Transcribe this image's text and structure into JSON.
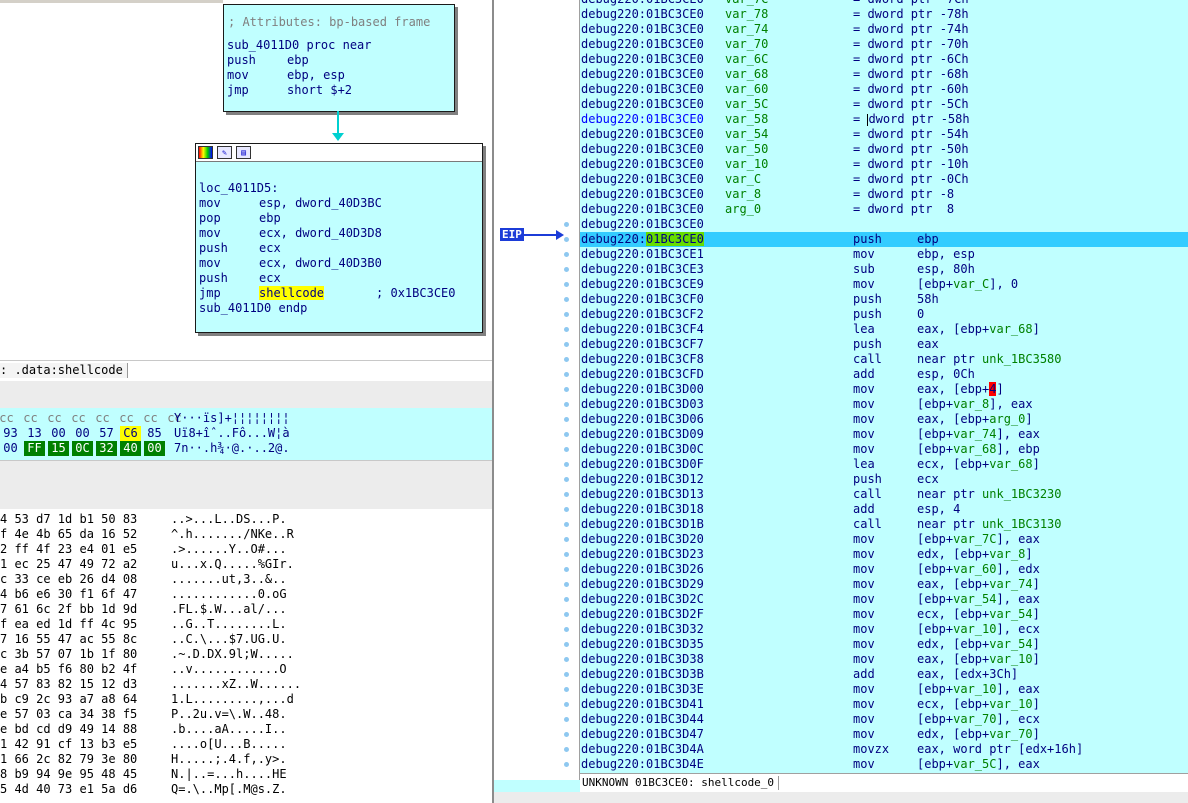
{
  "graph": {
    "node1": {
      "comment": "; Attributes: bp-based frame",
      "lines": [
        {
          "text": "sub_4011D0 proc near"
        },
        {
          "mnem": "push",
          "op": "ebp"
        },
        {
          "mnem": "mov",
          "op": "ebp, esp"
        },
        {
          "mnem": "jmp",
          "op": "short $+2"
        }
      ]
    },
    "node2": {
      "label": "loc_4011D5:",
      "lines": [
        {
          "mnem": "mov",
          "op": "esp, dword_40D3BC"
        },
        {
          "mnem": "pop",
          "op": "ebp"
        },
        {
          "mnem": "mov",
          "op": "ecx, dword_40D3D8"
        },
        {
          "mnem": "push",
          "op": "ecx"
        },
        {
          "mnem": "mov",
          "op": "ecx, dword_40D3B0"
        },
        {
          "mnem": "push",
          "op": "ecx"
        }
      ],
      "jmp_mnem": "jmp",
      "jmp_target": "shellcode",
      "jmp_comment": "; 0x1BC3CE0",
      "endp": "sub_4011D0 endp"
    }
  },
  "address_bar": ": .data:shellcode",
  "hex_view_1": {
    "rows": [
      {
        "bytes": [
          "cc",
          "cc",
          "cc",
          "cc",
          "cc",
          "cc",
          "cc",
          "cc"
        ],
        "ascii": "Y···ïs]+¦¦¦¦¦¦¦¦"
      },
      {
        "bytes": [
          "93",
          "13",
          "00",
          "00",
          "57",
          "C6",
          "85"
        ],
        "ascii": "Uï8+îˆ..Fô...W¦à"
      },
      {
        "bytes": [
          "00",
          "FF",
          "15",
          "0C",
          "32",
          "40",
          "00"
        ],
        "ascii": "7n··.h¾·@.·..2@."
      }
    ]
  },
  "hex_view_2": {
    "rows": [
      {
        "hex": "4 53 d7 1d b1 50 83",
        "ascii": "..>...L..DS...P."
      },
      {
        "hex": "f 4e 4b 65 da 16 52",
        "ascii": "^.h......./NKe..R"
      },
      {
        "hex": "2 ff 4f 23 e4 01 e5",
        "ascii": ".>......Y..O#..."
      },
      {
        "hex": "1 ec 25 47 49 72 a2",
        "ascii": "u...x.Q.....%GIr."
      },
      {
        "hex": "c 33 ce eb 26 d4 08",
        "ascii": ".......ut,3..&.."
      },
      {
        "hex": "4 b6 e6 30 f1 6f 47",
        "ascii": "............0.oG"
      },
      {
        "hex": "7 61 6c 2f bb 1d 9d",
        "ascii": ".FL.$.W...al/..."
      },
      {
        "hex": "f ea ed 1d ff 4c 95",
        "ascii": "..G..T........L."
      },
      {
        "hex": "7 16 55 47 ac 55 8c",
        "ascii": "..C.\\...$7.UG.U."
      },
      {
        "hex": "c 3b 57 07 1b 1f 80",
        "ascii": ".~.D.DX.9l;W....."
      },
      {
        "hex": "e a4 b5 f6 80 b2 4f",
        "ascii": "..v............O"
      },
      {
        "hex": "4 57 83 82 15 12 d3",
        "ascii": ".......xZ..W......"
      },
      {
        "hex": "b c9 2c 93 a7 a8 64",
        "ascii": "1.L.........,...d"
      },
      {
        "hex": "e 57 03 ca 34 38 f5",
        "ascii": "P..2u.v=\\.W..48."
      },
      {
        "hex": "e bd cd d9 49 14 88",
        "ascii": ".b....aA.....I.."
      },
      {
        "hex": "1 42 91 cf 13 b3 e5",
        "ascii": "....o[U...B....."
      },
      {
        "hex": "1 66 2c 82 79 3e 80",
        "ascii": "H.....;.4.f,.y>."
      },
      {
        "hex": "8 b9 94 9e 95 48 45",
        "ascii": "N.|..=...h....HE"
      },
      {
        "hex": "5 4d 40 73 e1 5a d6",
        "ascii": "Q=.\\..Mp[.M@s.Z."
      }
    ]
  },
  "eip_label": "EIP",
  "listing": {
    "rows": [
      {
        "addr": "debug220:01BC3CE0",
        "var": "var_7C",
        "eq": "= dword ptr -7Ch"
      },
      {
        "addr": "debug220:01BC3CE0",
        "var": "var_78",
        "eq": "= dword ptr -78h"
      },
      {
        "addr": "debug220:01BC3CE0",
        "var": "var_74",
        "eq": "= dword ptr -74h"
      },
      {
        "addr": "debug220:01BC3CE0",
        "var": "var_70",
        "eq": "= dword ptr -70h"
      },
      {
        "addr": "debug220:01BC3CE0",
        "var": "var_6C",
        "eq": "= dword ptr -6Ch"
      },
      {
        "addr": "debug220:01BC3CE0",
        "var": "var_68",
        "eq": "= dword ptr -68h"
      },
      {
        "addr": "debug220:01BC3CE0",
        "var": "var_60",
        "eq": "= dword ptr -60h"
      },
      {
        "addr": "debug220:01BC3CE0",
        "var": "var_5C",
        "eq": "= dword ptr -5Ch"
      },
      {
        "addr": "debug220:01BC3CE0",
        "var": "var_58",
        "eq": "= dword ptr -58h",
        "blue": true,
        "cursor": true
      },
      {
        "addr": "debug220:01BC3CE0",
        "var": "var_54",
        "eq": "= dword ptr -54h"
      },
      {
        "addr": "debug220:01BC3CE0",
        "var": "var_50",
        "eq": "= dword ptr -50h"
      },
      {
        "addr": "debug220:01BC3CE0",
        "var": "var_10",
        "eq": "= dword ptr -10h"
      },
      {
        "addr": "debug220:01BC3CE0",
        "var": "var_C",
        "eq": "= dword ptr -0Ch"
      },
      {
        "addr": "debug220:01BC3CE0",
        "var": "var_8",
        "eq": "= dword ptr -8"
      },
      {
        "addr": "debug220:01BC3CE0",
        "var": "arg_0",
        "eq": "= dword ptr  8"
      },
      {
        "addr": "debug220:01BC3CE0"
      },
      {
        "addr": "debug220:01BC3CE0",
        "mnem": "push",
        "op": "ebp",
        "current": true
      },
      {
        "addr": "debug220:01BC3CE1",
        "mnem": "mov",
        "op": "ebp, esp"
      },
      {
        "addr": "debug220:01BC3CE3",
        "mnem": "sub",
        "op": "esp, 80h"
      },
      {
        "addr": "debug220:01BC3CE9",
        "mnem": "mov",
        "op": "[ebp+var_C], 0"
      },
      {
        "addr": "debug220:01BC3CF0",
        "mnem": "push",
        "op": "58h"
      },
      {
        "addr": "debug220:01BC3CF2",
        "mnem": "push",
        "op": "0"
      },
      {
        "addr": "debug220:01BC3CF4",
        "mnem": "lea",
        "op": "eax, [ebp+var_68]"
      },
      {
        "addr": "debug220:01BC3CF7",
        "mnem": "push",
        "op": "eax"
      },
      {
        "addr": "debug220:01BC3CF8",
        "mnem": "call",
        "op": "near ptr unk_1BC3580"
      },
      {
        "addr": "debug220:01BC3CFD",
        "mnem": "add",
        "op": "esp, 0Ch"
      },
      {
        "addr": "debug220:01BC3D00",
        "mnem": "mov",
        "op": "eax, [ebp+4]",
        "redmark": true
      },
      {
        "addr": "debug220:01BC3D03",
        "mnem": "mov",
        "op": "[ebp+var_8], eax"
      },
      {
        "addr": "debug220:01BC3D06",
        "mnem": "mov",
        "op": "eax, [ebp+arg_0]"
      },
      {
        "addr": "debug220:01BC3D09",
        "mnem": "mov",
        "op": "[ebp+var_74], eax"
      },
      {
        "addr": "debug220:01BC3D0C",
        "mnem": "mov",
        "op": "[ebp+var_68], ebp"
      },
      {
        "addr": "debug220:01BC3D0F",
        "mnem": "lea",
        "op": "ecx, [ebp+var_68]"
      },
      {
        "addr": "debug220:01BC3D12",
        "mnem": "push",
        "op": "ecx"
      },
      {
        "addr": "debug220:01BC3D13",
        "mnem": "call",
        "op": "near ptr unk_1BC3230"
      },
      {
        "addr": "debug220:01BC3D18",
        "mnem": "add",
        "op": "esp, 4"
      },
      {
        "addr": "debug220:01BC3D1B",
        "mnem": "call",
        "op": "near ptr unk_1BC3130"
      },
      {
        "addr": "debug220:01BC3D20",
        "mnem": "mov",
        "op": "[ebp+var_7C], eax"
      },
      {
        "addr": "debug220:01BC3D23",
        "mnem": "mov",
        "op": "edx, [ebp+var_8]"
      },
      {
        "addr": "debug220:01BC3D26",
        "mnem": "mov",
        "op": "[ebp+var_60], edx"
      },
      {
        "addr": "debug220:01BC3D29",
        "mnem": "mov",
        "op": "eax, [ebp+var_74]"
      },
      {
        "addr": "debug220:01BC3D2C",
        "mnem": "mov",
        "op": "[ebp+var_54], eax"
      },
      {
        "addr": "debug220:01BC3D2F",
        "mnem": "mov",
        "op": "ecx, [ebp+var_54]"
      },
      {
        "addr": "debug220:01BC3D32",
        "mnem": "mov",
        "op": "[ebp+var_10], ecx"
      },
      {
        "addr": "debug220:01BC3D35",
        "mnem": "mov",
        "op": "edx, [ebp+var_54]"
      },
      {
        "addr": "debug220:01BC3D38",
        "mnem": "mov",
        "op": "eax, [ebp+var_10]"
      },
      {
        "addr": "debug220:01BC3D3B",
        "mnem": "add",
        "op": "eax, [edx+3Ch]"
      },
      {
        "addr": "debug220:01BC3D3E",
        "mnem": "mov",
        "op": "[ebp+var_10], eax"
      },
      {
        "addr": "debug220:01BC3D41",
        "mnem": "mov",
        "op": "ecx, [ebp+var_10]"
      },
      {
        "addr": "debug220:01BC3D44",
        "mnem": "mov",
        "op": "[ebp+var_70], ecx"
      },
      {
        "addr": "debug220:01BC3D47",
        "mnem": "mov",
        "op": "edx, [ebp+var_70]"
      },
      {
        "addr": "debug220:01BC3D4A",
        "mnem": "movzx",
        "op": "eax, word ptr [edx+16h]"
      },
      {
        "addr": "debug220:01BC3D4E",
        "mnem": "mov",
        "op": "[ebp+var_5C], eax"
      }
    ]
  },
  "status_bar": "UNKNOWN 01BC3CE0: shellcode_0",
  "colors": {
    "node_bg": "#c0ffff",
    "listing_bg": "#c0ffff",
    "current_line": "#33ccff",
    "eip_marker": "#1c3cd8",
    "highlight_yellow": "#ffff00",
    "highlight_green": "#66dd00",
    "highlight_red": "#ff0000",
    "symbol_green": "#008000",
    "code_navy": "#000080"
  }
}
